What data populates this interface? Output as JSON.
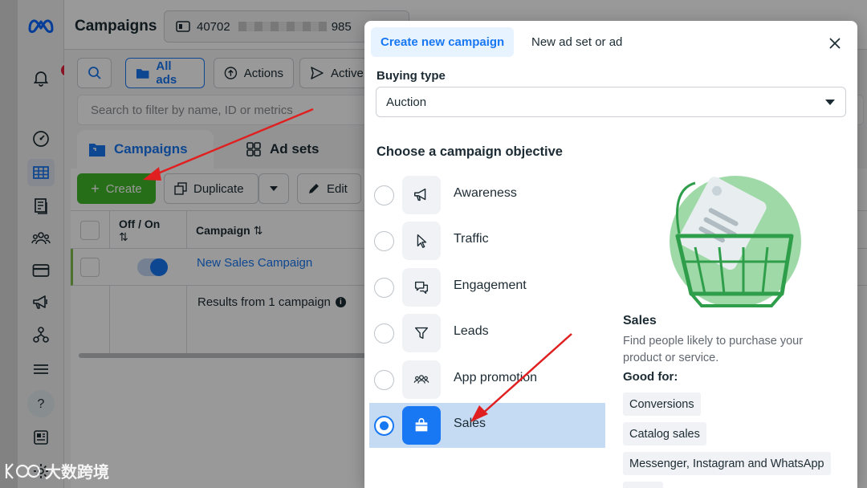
{
  "nav": {
    "notification_count": "5",
    "items": [
      "bell-icon",
      "gauge-icon",
      "table-icon",
      "pages-icon",
      "audience-icon",
      "billing-icon",
      "megaphone-icon",
      "hierarchy-icon",
      "menu-icon",
      "help-icon",
      "news-icon",
      "settings-icon"
    ]
  },
  "header": {
    "title": "Campaigns",
    "account_id_start": "40702",
    "account_id_end": "985"
  },
  "toolbar": {
    "all_ads": "All ads",
    "actions": "Actions",
    "active": "Active",
    "search_placeholder": "Search to filter by name, ID or metrics"
  },
  "tabs": {
    "campaigns": "Campaigns",
    "adsets": "Ad sets"
  },
  "grid": {
    "create": "Create",
    "duplicate": "Duplicate",
    "edit": "Edit",
    "col_offon": "Off / On",
    "col_campaign": "Campaign",
    "campaign_name": "New Sales Campaign",
    "results": "Results from 1 campaign"
  },
  "modal": {
    "tab_create": "Create new campaign",
    "tab_adset": "New ad set or ad",
    "buying_type_label": "Buying type",
    "buying_type_value": "Auction",
    "objective_heading": "Choose a campaign objective",
    "objectives": [
      {
        "label": "Awareness",
        "icon": "megaphone-icon"
      },
      {
        "label": "Traffic",
        "icon": "cursor-icon"
      },
      {
        "label": "Engagement",
        "icon": "chat-icon"
      },
      {
        "label": "Leads",
        "icon": "funnel-icon"
      },
      {
        "label": "App promotion",
        "icon": "people-icon"
      },
      {
        "label": "Sales",
        "icon": "shopping-bag-icon"
      }
    ],
    "selected_objective": "Sales",
    "description": {
      "title": "Sales",
      "text": "Find people likely to purchase your product or service.",
      "good_for_label": "Good for:",
      "good_for": [
        "Conversions",
        "Catalog sales",
        "Messenger, Instagram and WhatsApp"
      ]
    }
  },
  "watermark": "大数跨境",
  "colors": {
    "accent": "#1877f2",
    "create_green": "#42b72a",
    "selected_row": "#c5dbf4",
    "arrow_red": "#e02020"
  }
}
